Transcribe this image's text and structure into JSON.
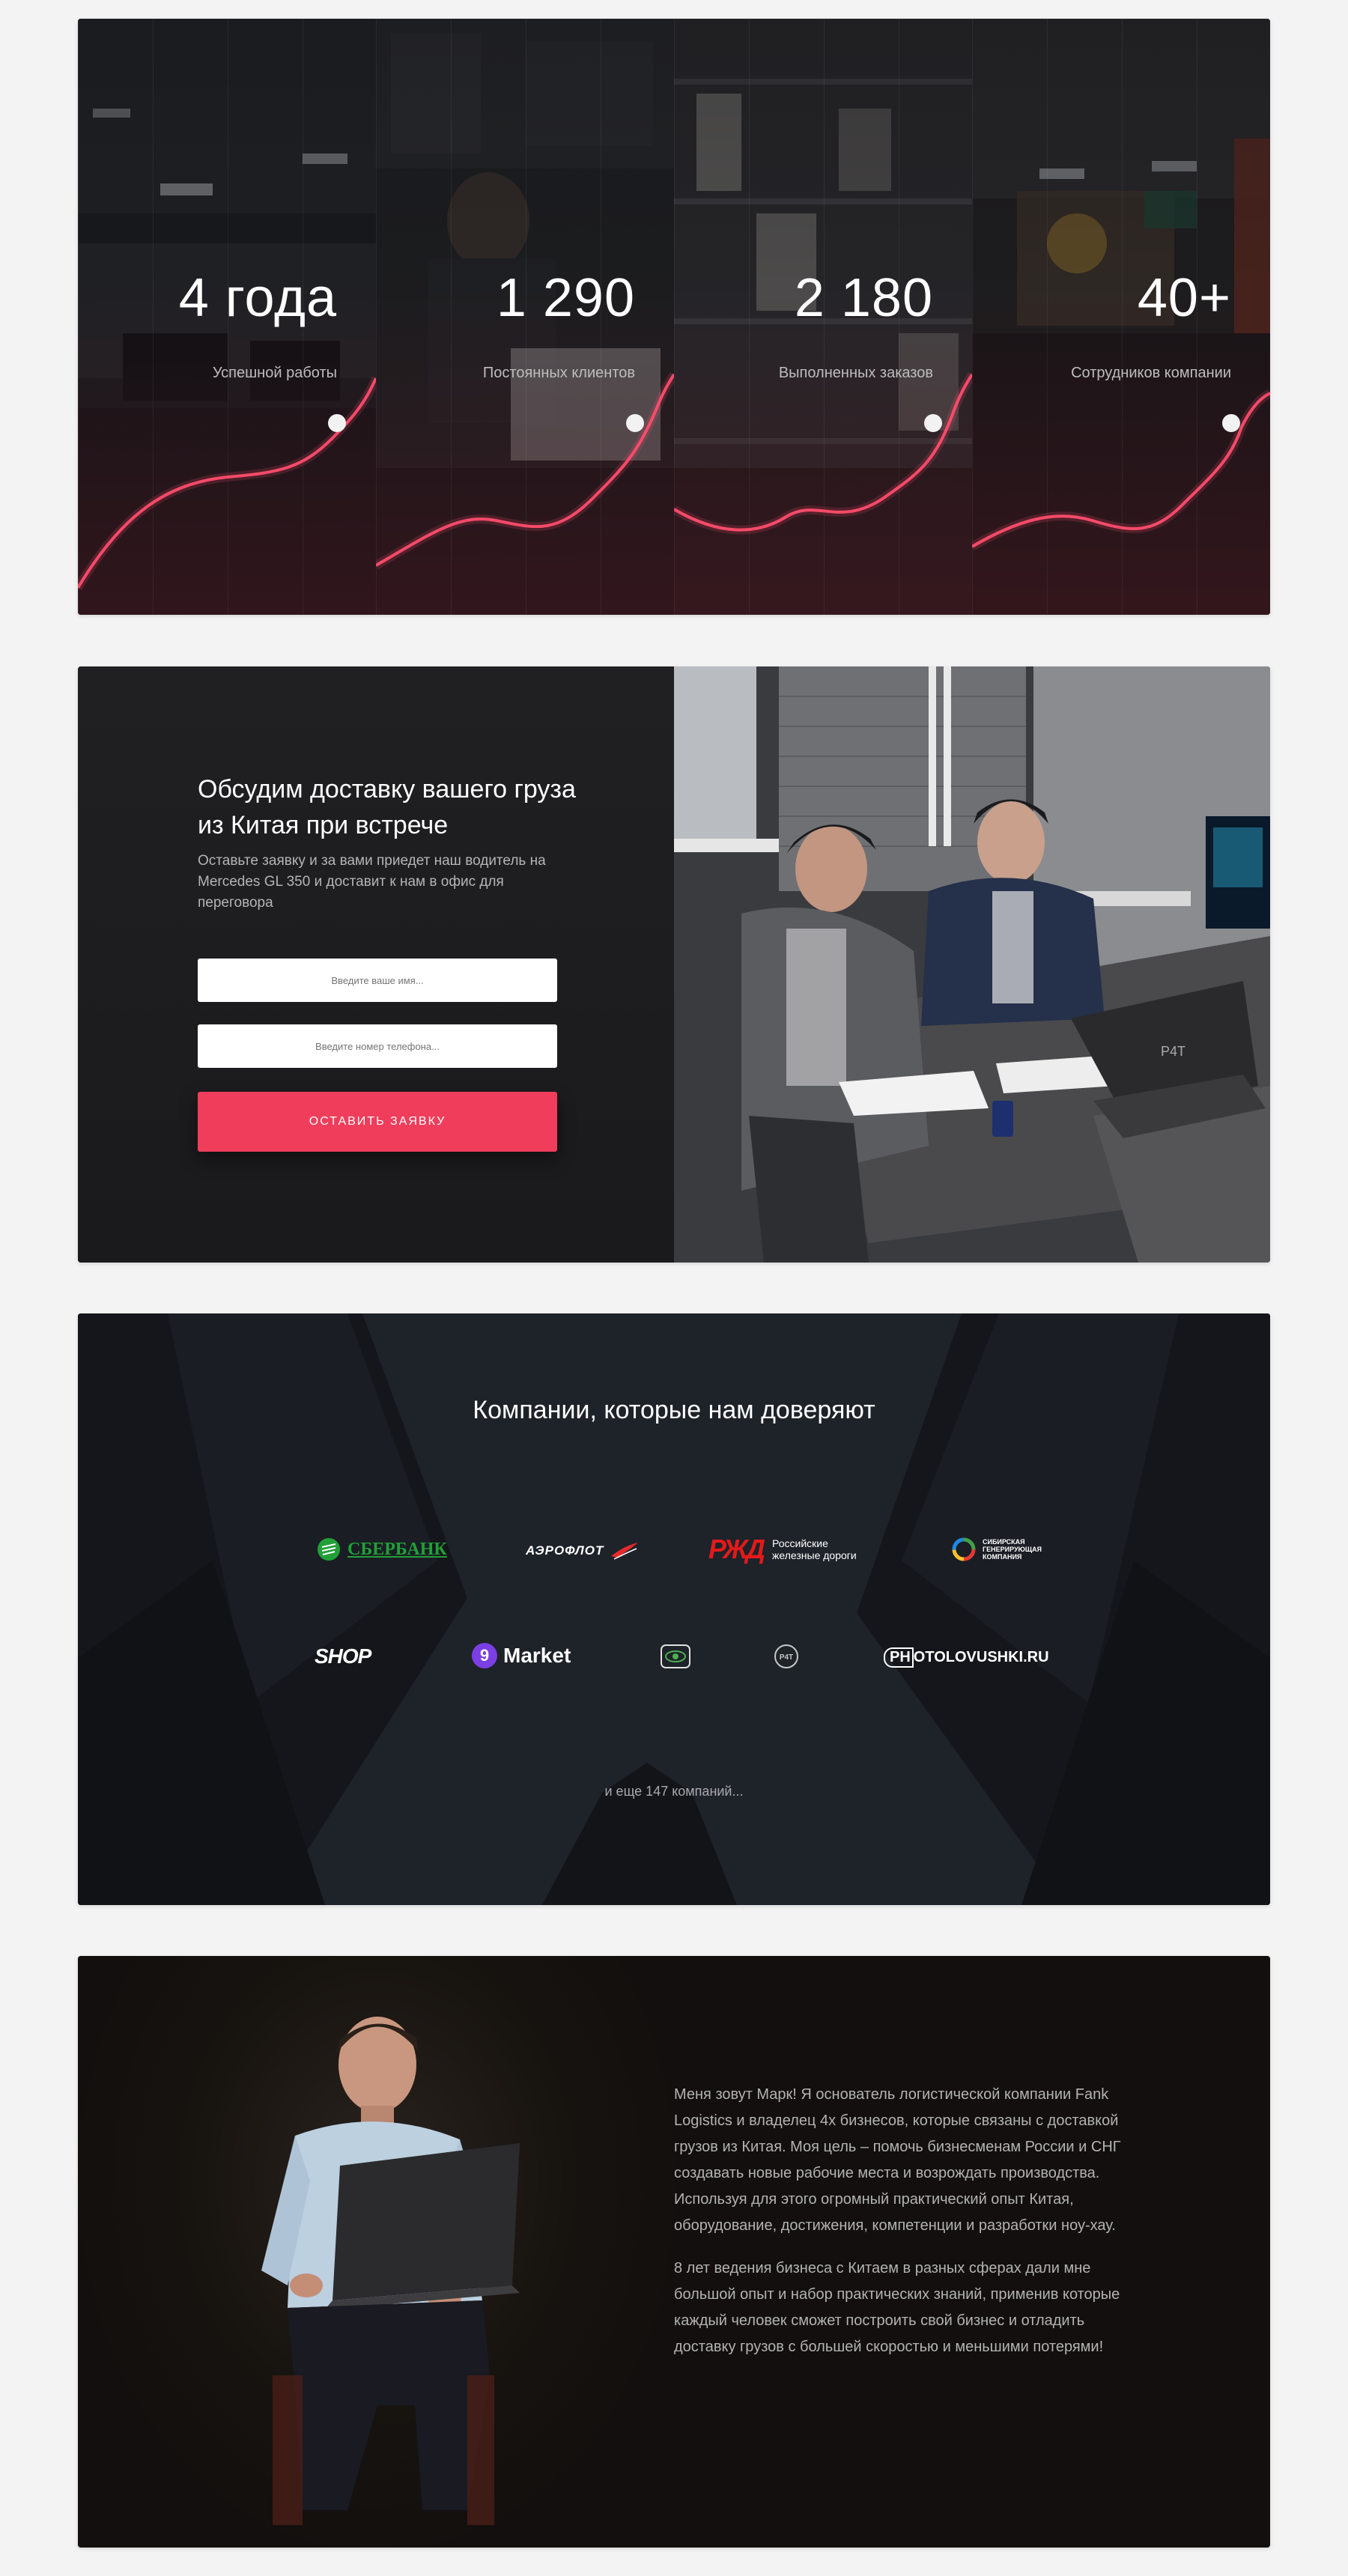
{
  "stats": [
    {
      "number": "4 года",
      "label": "Успешной работы"
    },
    {
      "number": "1 290",
      "label": "Постоянных клиентов"
    },
    {
      "number": "2 180",
      "label": "Выполненных заказов"
    },
    {
      "number": "40+",
      "label": "Сотрудников компании"
    }
  ],
  "cta": {
    "title": "Обсудим доставку вашего груза из Китая при встрече",
    "subtitle": "Оставьте заявку и за вами приедет наш водитель на Mercedes GL 350 и доставит к нам в офис для переговора",
    "name_placeholder": "Введите ваше имя...",
    "phone_placeholder": "Введите номер телефона...",
    "button": "ОСТАВИТЬ ЗАЯВКУ",
    "laptop_logo": "P4T"
  },
  "partners": {
    "title": "Компании, которые нам доверяют",
    "logos": {
      "sber": "СБЕРБАНК",
      "aeroflot": "АЭРОФЛОТ",
      "rzd_mark": "РЖД",
      "rzd_line1": "Российские",
      "rzd_line2": "железные дороги",
      "sibir_line1": "СИБИРСКАЯ",
      "sibir_line2": "ГЕНЕРИРУЮЩАЯ",
      "sibir_line3": "КОМПАНИЯ",
      "shop": "SHOP",
      "market_num": "9",
      "market": "Market",
      "p4t": "P4T",
      "photo_a": "PH",
      "photo_b": "OTOLOVUSHKI.RU"
    },
    "more": "и еще 147 компаний..."
  },
  "about": {
    "paragraphs": [
      "Меня зовут Марк! Я основатель логистической компании Fank Logistics и владелец 4х бизнесов, которые связаны с доставкой грузов из Китая. Моя цель – помочь бизнесменам России и СНГ создавать новые рабочие места и возрождать производства. Используя для этого огромный практический опыт Китая, оборудование, достижения, компетенции и разработки ноу-хау.",
      "8 лет ведения бизнеса с Китаем в разных сферах дали мне большой опыт и набор практических знаний, применив которые каждый человек сможет построить свой бизнес и отладить доставку грузов с большей скоростью и меньшими потерями!"
    ]
  },
  "colors": {
    "accent": "#ef3d5b",
    "page_bg": "#f3f3f3",
    "card_dark": "#1d1d1f",
    "curve": "#ff4d6d"
  }
}
